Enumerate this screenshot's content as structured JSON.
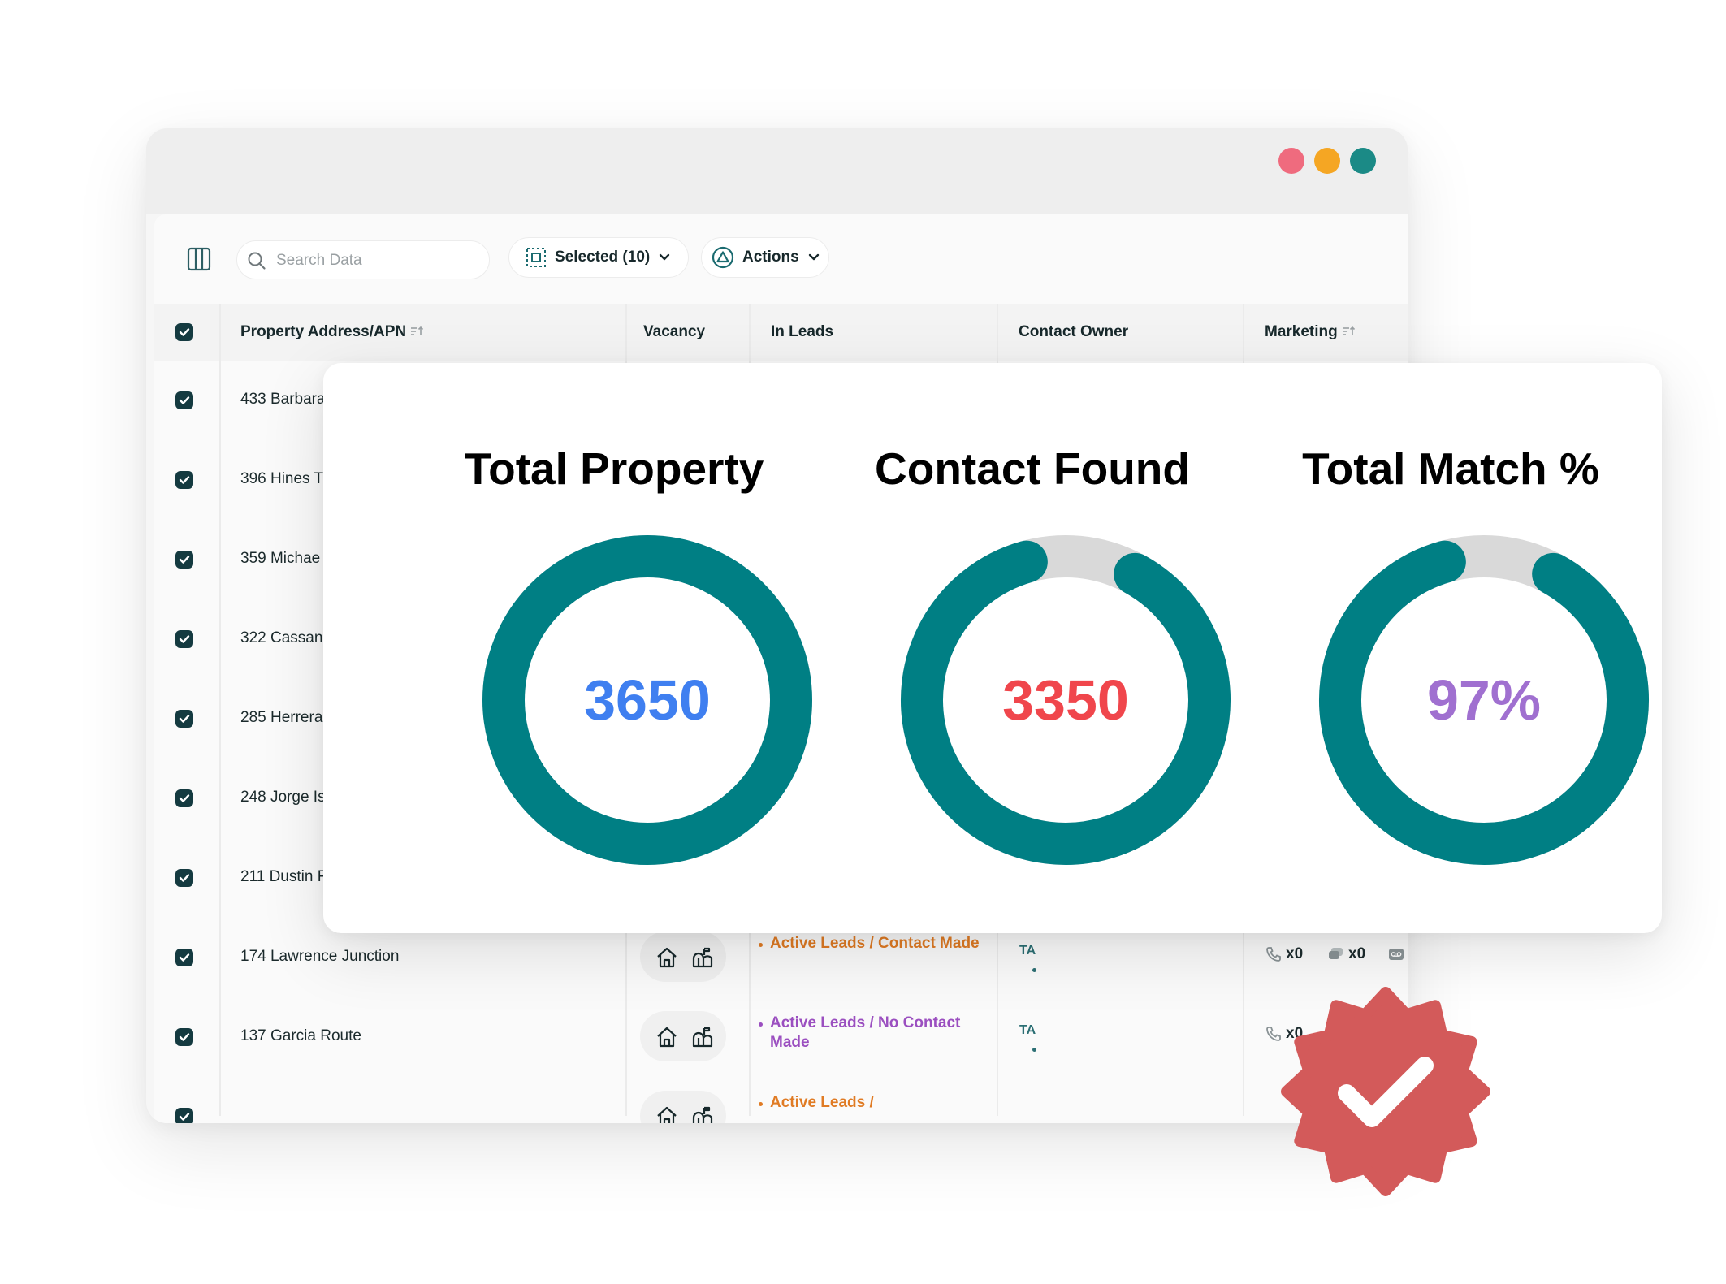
{
  "window": {
    "controls": [
      {
        "name": "close",
        "color": "#ef6b7e"
      },
      {
        "name": "minimize",
        "color": "#f5a623"
      },
      {
        "name": "maximize",
        "color": "#1b8a86"
      }
    ]
  },
  "toolbar": {
    "search_placeholder": "Search Data",
    "selected_label": "Selected (10)",
    "actions_label": "Actions"
  },
  "table": {
    "headers": {
      "address": "Property Address/APN",
      "vacancy": "Vacancy",
      "in_leads": "In Leads",
      "contact_owner": "Contact Owner",
      "marketing": "Marketing"
    },
    "rows": [
      {
        "address": "433 Barbara"
      },
      {
        "address": "396 Hines T"
      },
      {
        "address": "359 Michae"
      },
      {
        "address": "322 Cassan"
      },
      {
        "address": "285 Herrera"
      },
      {
        "address": "248 Jorge Is"
      },
      {
        "address": "211 Dustin F"
      },
      {
        "address": "174 Lawrence Junction",
        "status": "Active Leads / Contact Made",
        "status_color": "#e07b24",
        "owner": "TA",
        "calls": "x0",
        "messages": "x0"
      },
      {
        "address": "137 Garcia Route",
        "status": "Active Leads / No Contact Made",
        "status_color": "#9b4fc0",
        "owner": "TA",
        "calls": "x0"
      },
      {
        "address": "",
        "status": "Active Leads /",
        "status_color": "#e07b24"
      }
    ]
  },
  "stats": [
    {
      "title": "Total Property",
      "value": "3650",
      "value_color": "#3f7ff0",
      "fill_fraction": 1.0
    },
    {
      "title": "Contact Found",
      "value": "3350",
      "value_color": "#f0464c",
      "fill_fraction": 0.918
    },
    {
      "title": "Total Match %",
      "value": "97%",
      "value_color": "#a070d0",
      "fill_fraction": 0.918
    }
  ],
  "colors": {
    "ring": "#007f84",
    "ring_track": "#d9d9d9",
    "badge": "#d35a5a",
    "checkbox": "#143a40"
  }
}
